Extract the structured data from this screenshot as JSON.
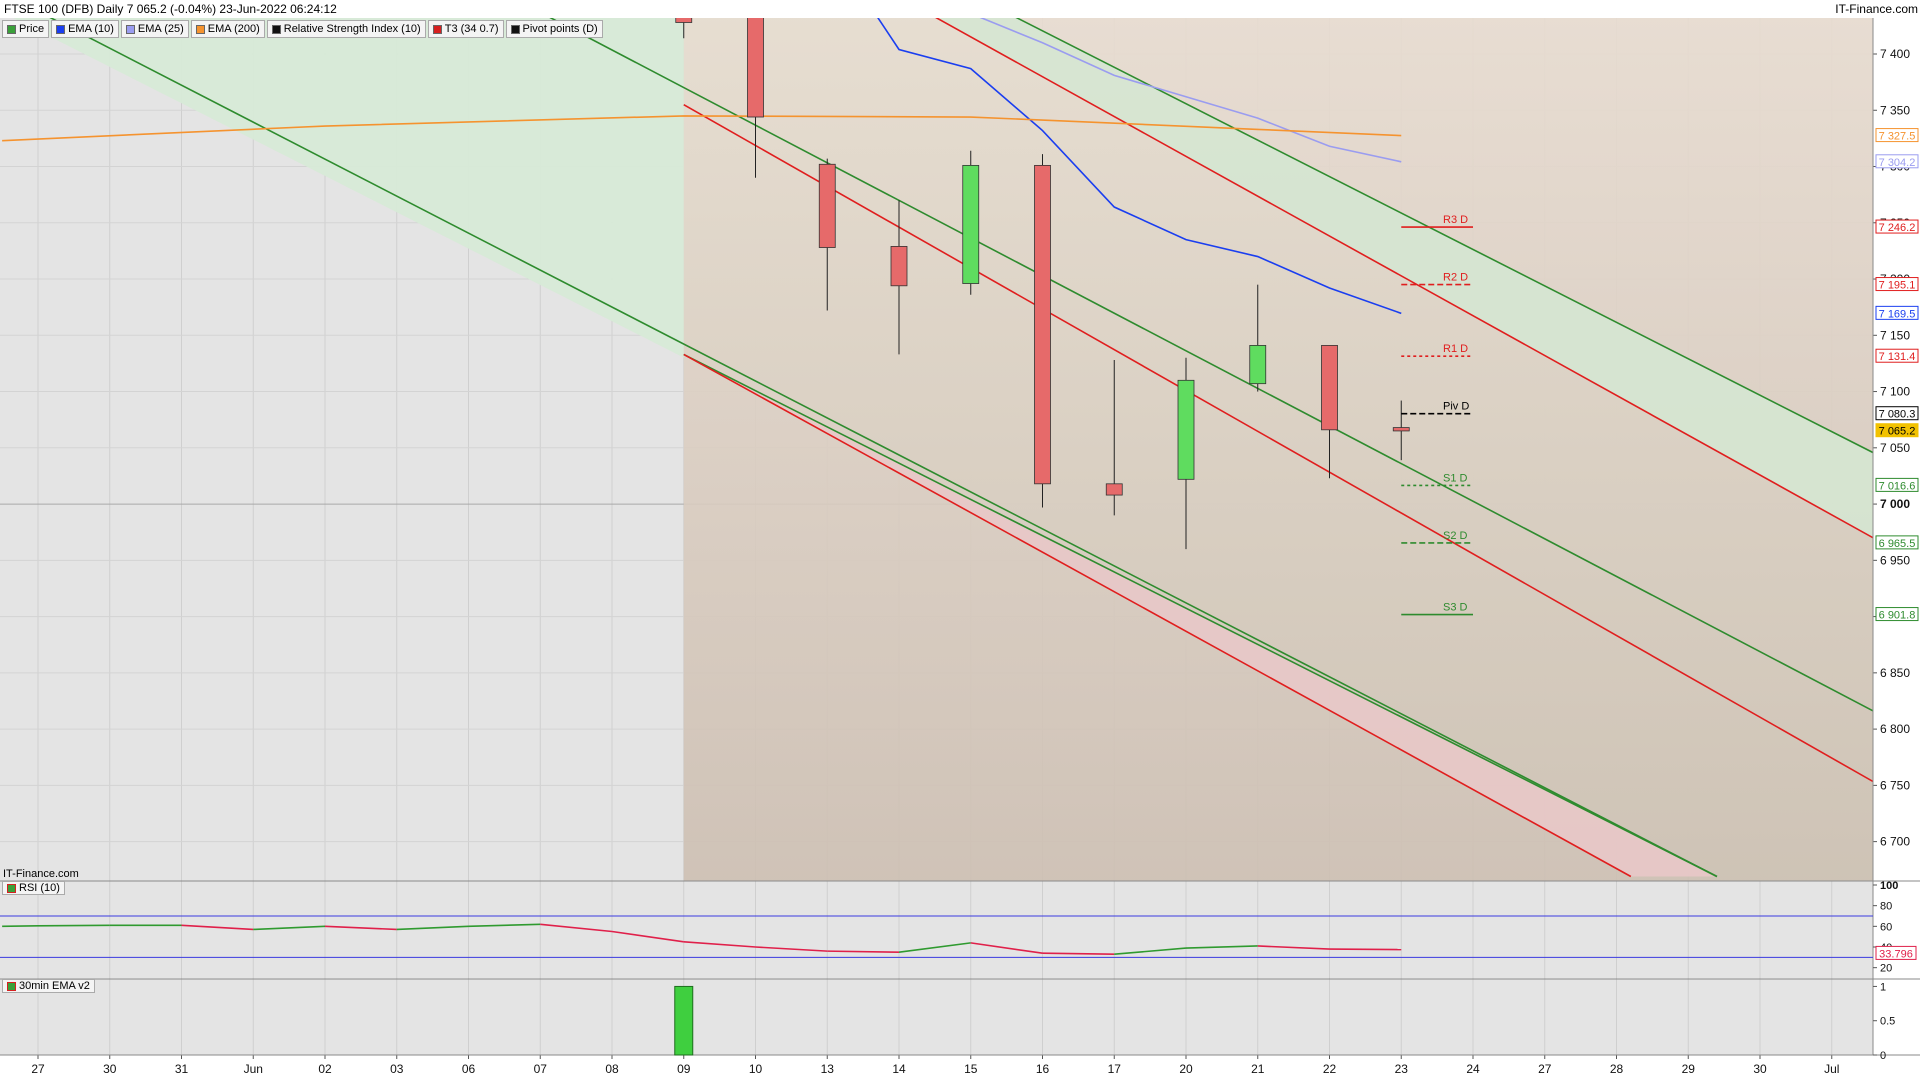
{
  "header": {
    "title": "FTSE 100 (DFB) Daily 7 065.2 (-0.04%) 23-Jun-2022 06:24:12",
    "brand": "IT-Finance.com",
    "watermark": "IT-Finance.com"
  },
  "legend": [
    {
      "label": "Price",
      "color": "#3aa03a"
    },
    {
      "label": "EMA (10)",
      "color": "#1a3ef0"
    },
    {
      "label": "EMA (25)",
      "color": "#9a9cf0"
    },
    {
      "label": "EMA (200)",
      "color": "#f5932f"
    },
    {
      "label": "Relative Strength Index (10)",
      "color": "#111111"
    },
    {
      "label": "T3 (34 0.7)",
      "color": "#d62020"
    },
    {
      "label": "Pivot points (D)",
      "color": "#111111"
    }
  ],
  "panes": {
    "rsi_label": "RSI (10)",
    "ema30_label": "30min EMA v2"
  },
  "chart_data": {
    "type": "candlestick",
    "x_labels": [
      "27",
      "30",
      "31",
      "Jun",
      "02",
      "03",
      "06",
      "07",
      "08",
      "09",
      "10",
      "13",
      "14",
      "15",
      "16",
      "17",
      "20",
      "21",
      "22",
      "23",
      "24",
      "27",
      "28",
      "29",
      "30",
      "Jul"
    ],
    "price_axis": {
      "ylim": [
        6665,
        7432
      ],
      "ticks": [
        "7 400",
        "7 350",
        "7 300",
        "7 250",
        "7 200",
        "7 150",
        "7 100",
        "7 050",
        "7 000",
        "6 950",
        "6 900",
        "6 850",
        "6 800",
        "6 750",
        "6 700"
      ],
      "tick_values": [
        7400,
        7350,
        7300,
        7250,
        7200,
        7150,
        7100,
        7050,
        7000,
        6950,
        6900,
        6850,
        6800,
        6750,
        6700
      ]
    },
    "candles": [
      {
        "slot": 9,
        "open": 7443,
        "close": 7428,
        "high": 7445,
        "low": 7414
      },
      {
        "slot": 10,
        "open": 7436,
        "close": 7344,
        "high": 7440,
        "low": 7290
      },
      {
        "slot": 11,
        "open": 7302,
        "close": 7228,
        "high": 7307,
        "low": 7172
      },
      {
        "slot": 12,
        "open": 7229,
        "close": 7194,
        "high": 7270,
        "low": 7133
      },
      {
        "slot": 13,
        "open": 7196,
        "close": 7301,
        "high": 7314,
        "low": 7186
      },
      {
        "slot": 14,
        "open": 7301,
        "close": 7018,
        "high": 7311,
        "low": 6997
      },
      {
        "slot": 15,
        "open": 7018,
        "close": 7008,
        "high": 7128,
        "low": 6990
      },
      {
        "slot": 16,
        "open": 7022,
        "close": 7110,
        "high": 7130,
        "low": 6960
      },
      {
        "slot": 17,
        "open": 7107,
        "close": 7141,
        "high": 7195,
        "low": 7100
      },
      {
        "slot": 18,
        "open": 7141,
        "close": 7066,
        "high": 7141,
        "low": 7023
      },
      {
        "slot": 19,
        "open": 7068,
        "close": 7065,
        "high": 7092,
        "low": 7039
      }
    ],
    "series": [
      {
        "name": "EMA (10)",
        "color": "#1a3ef0",
        "points": [
          [
            11,
            7500
          ],
          [
            12,
            7404
          ],
          [
            13,
            7387
          ],
          [
            14,
            7332
          ],
          [
            15,
            7264
          ],
          [
            16,
            7235
          ],
          [
            17,
            7220
          ],
          [
            18,
            7192
          ],
          [
            19,
            7169.5
          ]
        ]
      },
      {
        "name": "EMA (25)",
        "color": "#9a9cf0",
        "points": [
          [
            13,
            7436
          ],
          [
            14,
            7410
          ],
          [
            15,
            7381
          ],
          [
            16,
            7362
          ],
          [
            17,
            7343
          ],
          [
            18,
            7318
          ],
          [
            19,
            7304.2
          ]
        ]
      },
      {
        "name": "EMA (200)",
        "color": "#f5932f",
        "points": [
          [
            -0.5,
            7323
          ],
          [
            4,
            7336
          ],
          [
            9,
            7345
          ],
          [
            13,
            7344
          ],
          [
            17,
            7333
          ],
          [
            19,
            7327.5
          ]
        ]
      }
    ],
    "channels": [
      {
        "color": "#2e8b2e",
        "points": [
          [
            0,
            7438
          ],
          [
            26,
            6740
          ]
        ]
      },
      {
        "color": "#2e8b2e",
        "points": [
          [
            0,
            7438
          ],
          [
            26,
            6740
          ]
        ]
      }
    ],
    "trend_lines": [
      {
        "color": "#2e8b2e",
        "points": [
          [
            0,
            7438
          ],
          [
            23.4,
            6669
          ]
        ]
      },
      {
        "color": "#2e8b2e",
        "points": [
          [
            9,
            7133
          ],
          [
            23.4,
            6669
          ]
        ]
      },
      {
        "color": "#e01e1e",
        "points": [
          [
            9,
            7133
          ],
          [
            22.2,
            6669
          ]
        ]
      },
      {
        "color": "#e01e1e",
        "points": [
          [
            9,
            7355
          ],
          [
            26,
            6738
          ]
        ]
      },
      {
        "color": "#e01e1e",
        "points": [
          [
            12.3,
            7440
          ],
          [
            26,
            6955
          ]
        ]
      },
      {
        "color": "#2e8b2e",
        "points": [
          [
            7,
            7437
          ],
          [
            26,
            6802
          ]
        ]
      },
      {
        "color": "#2e8b2e",
        "points": [
          [
            13.4,
            7440
          ],
          [
            26,
            7032
          ]
        ]
      }
    ],
    "pivots": [
      {
        "label": "R3 D",
        "value": 7246.2,
        "color": "#e01e1e",
        "style": "solid"
      },
      {
        "label": "R2 D",
        "value": 7195.1,
        "color": "#e01e1e",
        "style": "dashed"
      },
      {
        "label": "R1 D",
        "value": 7131.4,
        "color": "#e01e1e",
        "style": "dotted"
      },
      {
        "label": "Piv D",
        "value": 7080.3,
        "color": "#000000",
        "style": "dashed"
      },
      {
        "label": "S1 D",
        "value": 7016.6,
        "color": "#2e8b2e",
        "style": "dotted"
      },
      {
        "label": "S2 D",
        "value": 6965.5,
        "color": "#2e8b2e",
        "style": "dashed"
      },
      {
        "label": "S3 D",
        "value": 6901.8,
        "color": "#2e8b2e",
        "style": "solid"
      }
    ],
    "price_tags": [
      {
        "text": "7 327.5",
        "value": 7327.5,
        "color": "#f5932f"
      },
      {
        "text": "7 304.2",
        "value": 7304.2,
        "color": "#9a9cf0"
      },
      {
        "text": "7 246.2",
        "value": 7246.2,
        "color": "#e01e1e"
      },
      {
        "text": "7 195.1",
        "value": 7195.1,
        "color": "#e01e1e"
      },
      {
        "text": "7 169.5",
        "value": 7169.5,
        "color": "#1a3ef0"
      },
      {
        "text": "7 131.4",
        "value": 7131.4,
        "color": "#e01e1e"
      },
      {
        "text": "7 080.3",
        "value": 7080.3,
        "color": "#000000"
      },
      {
        "text": "7 065.2",
        "value": 7065.2,
        "color": "#f2c200"
      },
      {
        "text": "7 016.6",
        "value": 7016.6,
        "color": "#2e8b2e"
      },
      {
        "text": "6 965.5",
        "value": 6965.5,
        "color": "#2e8b2e"
      },
      {
        "text": "6 901.8",
        "value": 6901.8,
        "color": "#2e8b2e"
      }
    ],
    "rsi": {
      "ylim": [
        10,
        100
      ],
      "ticks": [
        "100",
        "80",
        "60",
        "40",
        "20"
      ],
      "tick_values": [
        100,
        80,
        60,
        40,
        20
      ],
      "levels": [
        70,
        30
      ],
      "last_text": "33.796",
      "last_value": 33.796,
      "points": [
        [
          -0.5,
          60
        ],
        [
          0,
          60.5
        ],
        [
          1,
          61
        ],
        [
          2,
          61
        ],
        [
          3,
          57
        ],
        [
          4,
          60
        ],
        [
          5,
          57
        ],
        [
          6,
          60
        ],
        [
          7,
          62
        ],
        [
          8,
          55
        ],
        [
          9,
          45
        ],
        [
          10,
          40
        ],
        [
          11,
          36
        ],
        [
          12,
          35
        ],
        [
          13,
          44
        ],
        [
          14,
          34
        ],
        [
          15,
          33
        ],
        [
          16,
          39
        ],
        [
          17,
          41
        ],
        [
          18,
          38
        ],
        [
          19,
          37.5
        ]
      ]
    },
    "ema30": {
      "ylim": [
        0,
        1.05
      ],
      "ticks": [
        "1",
        "0.5",
        "0"
      ],
      "tick_values": [
        1,
        0.5,
        0
      ],
      "bars": [
        {
          "slot": 9,
          "value": 1,
          "color": "#3fcf3f"
        }
      ]
    }
  }
}
